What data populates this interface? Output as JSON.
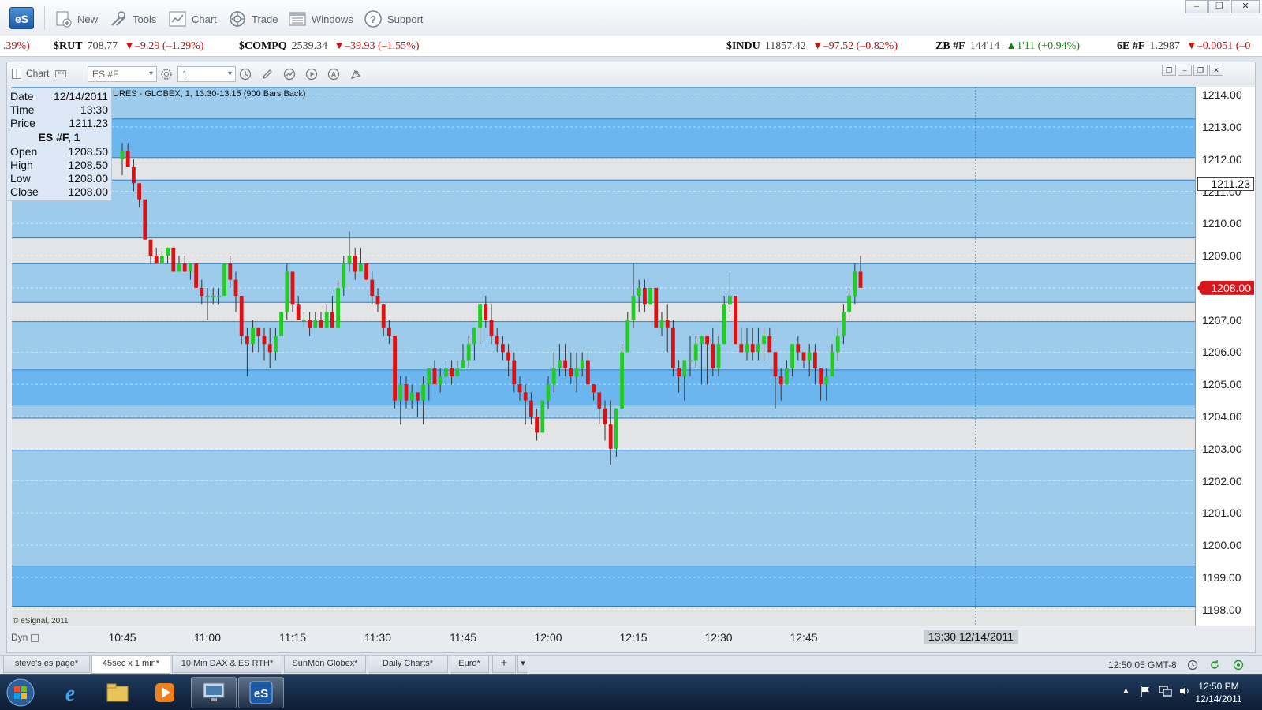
{
  "app": {
    "logo_text": "eS"
  },
  "toolbar": {
    "buttons": [
      {
        "label": "New",
        "icon": "new-page-icon"
      },
      {
        "label": "Tools",
        "icon": "tools-icon"
      },
      {
        "label": "Chart",
        "icon": "chart-icon"
      },
      {
        "label": "Trade",
        "icon": "trade-icon"
      },
      {
        "label": "Windows",
        "icon": "windows-icon"
      },
      {
        "label": "Support",
        "icon": "help-icon"
      }
    ],
    "window_controls": [
      "–",
      "❐",
      "✕"
    ]
  },
  "ticker": [
    {
      "symbol": "",
      "price": "",
      "change": ".39%)",
      "dir": "down"
    },
    {
      "symbol": "$RUT",
      "price": "708.77",
      "change": "▼–9.29 (–1.29%)",
      "dir": "down"
    },
    {
      "symbol": "$COMPQ",
      "price": "2539.34",
      "change": "▼–39.93 (–1.55%)",
      "dir": "down"
    },
    {
      "symbol": "$INDU",
      "price": "11857.42",
      "change": "▼–97.52 (–0.82%)",
      "dir": "down"
    },
    {
      "symbol": "ZB #F",
      "price": "144'14",
      "change": "▲1'11 (+0.94%)",
      "dir": "up"
    },
    {
      "symbol": "6E #F",
      "price": "1.2987",
      "change": "▼–0.0051 (–0",
      "dir": "down"
    }
  ],
  "chart_window": {
    "label": "Chart",
    "symbol_input": "ES #F",
    "interval_input": "1",
    "title": "URES - GLOBEX, 1, 13:30-13:15 (900 Bars Back)",
    "copyright": "© eSignal, 2011",
    "dyn_label": "Dyn"
  },
  "cursor_info": {
    "date_label": "Date",
    "date": "12/14/2011",
    "time_label": "Time",
    "time": "13:30",
    "price_label": "Price",
    "price": "1211.23",
    "series_label": "ES #F, 1",
    "open_label": "Open",
    "open": "1208.50",
    "high_label": "High",
    "high": "1208.50",
    "low_label": "Low",
    "low": "1208.00",
    "close_label": "Close",
    "close": "1208.00"
  },
  "chart_data": {
    "type": "candlestick",
    "ylim": [
      1197.5,
      1214.25
    ],
    "y_ticks": [
      "1214.00",
      "1213.00",
      "1212.00",
      "1211.00",
      "1210.00",
      "1209.00",
      "1208.00",
      "1207.00",
      "1206.00",
      "1205.00",
      "1204.00",
      "1203.00",
      "1202.00",
      "1201.00",
      "1200.00",
      "1199.00",
      "1198.00"
    ],
    "x_ticks": [
      "10:45",
      "11:00",
      "11:15",
      "11:30",
      "11:45",
      "12:00",
      "12:15",
      "12:30",
      "12:45"
    ],
    "last_price": "1208.00",
    "crosshair_price": "1211.23",
    "crosshair_time": "13:30 12/14/2011",
    "colors": {
      "up": "#22cc22",
      "down": "#dd1111",
      "band_dark": "#6cb6f0",
      "band_light": "#9ccbeb",
      "band_grey": "#e2e4e6"
    },
    "bands": [
      {
        "from": 1213.25,
        "to": 1214.25,
        "shade": "light"
      },
      {
        "from": 1212.05,
        "to": 1213.25,
        "shade": "dark"
      },
      {
        "from": 1211.35,
        "to": 1212.05,
        "shade": "grey"
      },
      {
        "from": 1209.55,
        "to": 1211.35,
        "shade": "light"
      },
      {
        "from": 1208.75,
        "to": 1209.55,
        "shade": "grey"
      },
      {
        "from": 1207.55,
        "to": 1208.75,
        "shade": "light"
      },
      {
        "from": 1206.95,
        "to": 1207.55,
        "shade": "grey"
      },
      {
        "from": 1205.45,
        "to": 1206.95,
        "shade": "light"
      },
      {
        "from": 1204.35,
        "to": 1205.45,
        "shade": "dark"
      },
      {
        "from": 1203.95,
        "to": 1204.35,
        "shade": "light"
      },
      {
        "from": 1202.95,
        "to": 1203.95,
        "shade": "grey"
      },
      {
        "from": 1199.35,
        "to": 1202.95,
        "shade": "light"
      },
      {
        "from": 1198.1,
        "to": 1199.35,
        "shade": "dark"
      },
      {
        "from": 1197.5,
        "to": 1198.1,
        "shade": "grey"
      }
    ],
    "candles": [
      [
        1212.0,
        1212.5,
        1211.5,
        1212.25
      ],
      [
        1212.25,
        1212.5,
        1211.75,
        1211.75
      ],
      [
        1211.75,
        1212.0,
        1211.0,
        1211.25
      ],
      [
        1211.25,
        1211.25,
        1210.5,
        1210.75
      ],
      [
        1210.75,
        1210.75,
        1209.5,
        1209.5
      ],
      [
        1209.5,
        1209.5,
        1208.75,
        1209.0
      ],
      [
        1209.0,
        1209.25,
        1208.75,
        1208.75
      ],
      [
        1208.75,
        1209.25,
        1208.75,
        1209.0
      ],
      [
        1209.0,
        1209.25,
        1208.75,
        1209.25
      ],
      [
        1209.25,
        1209.25,
        1208.5,
        1208.5
      ],
      [
        1208.5,
        1209.0,
        1208.5,
        1208.75
      ],
      [
        1208.75,
        1209.0,
        1208.5,
        1208.5
      ],
      [
        1208.5,
        1208.75,
        1208.25,
        1208.75
      ],
      [
        1208.75,
        1208.75,
        1208.0,
        1208.0
      ],
      [
        1208.0,
        1208.25,
        1207.5,
        1207.75
      ],
      [
        1207.75,
        1208.0,
        1207.0,
        1207.75
      ],
      [
        1207.75,
        1208.0,
        1207.5,
        1207.75
      ],
      [
        1207.75,
        1208.0,
        1207.5,
        1207.75
      ],
      [
        1207.75,
        1208.75,
        1207.75,
        1208.75
      ],
      [
        1208.75,
        1209.0,
        1208.0,
        1208.25
      ],
      [
        1208.25,
        1208.5,
        1207.25,
        1207.75
      ],
      [
        1207.75,
        1207.75,
        1206.25,
        1206.5
      ],
      [
        1206.5,
        1206.75,
        1205.25,
        1206.25
      ],
      [
        1206.25,
        1207.0,
        1206.0,
        1206.75
      ],
      [
        1206.75,
        1206.75,
        1206.0,
        1206.5
      ],
      [
        1206.5,
        1206.75,
        1205.75,
        1206.25
      ],
      [
        1206.25,
        1206.75,
        1205.5,
        1206.0
      ],
      [
        1206.0,
        1206.75,
        1205.75,
        1206.5
      ],
      [
        1206.5,
        1207.25,
        1206.5,
        1207.25
      ],
      [
        1207.25,
        1208.75,
        1207.0,
        1208.5
      ],
      [
        1208.5,
        1208.5,
        1207.25,
        1207.5
      ],
      [
        1207.5,
        1207.75,
        1207.0,
        1207.0
      ],
      [
        1207.0,
        1207.25,
        1206.75,
        1207.0
      ],
      [
        1207.0,
        1207.25,
        1206.5,
        1206.75
      ],
      [
        1206.75,
        1207.25,
        1206.75,
        1207.0
      ],
      [
        1207.0,
        1207.25,
        1206.75,
        1206.75
      ],
      [
        1206.75,
        1207.5,
        1206.75,
        1207.25
      ],
      [
        1207.25,
        1207.75,
        1206.75,
        1206.75
      ],
      [
        1206.75,
        1208.25,
        1206.75,
        1208.0
      ],
      [
        1208.0,
        1209.0,
        1207.75,
        1208.75
      ],
      [
        1208.75,
        1209.75,
        1208.5,
        1209.0
      ],
      [
        1209.0,
        1209.25,
        1208.25,
        1208.5
      ],
      [
        1208.5,
        1209.25,
        1208.5,
        1208.75
      ],
      [
        1208.75,
        1208.75,
        1208.25,
        1208.25
      ],
      [
        1208.25,
        1208.5,
        1207.5,
        1207.75
      ],
      [
        1207.75,
        1208.0,
        1207.25,
        1207.5
      ],
      [
        1207.5,
        1207.5,
        1206.5,
        1206.75
      ],
      [
        1206.75,
        1207.0,
        1206.25,
        1206.5
      ],
      [
        1206.5,
        1206.5,
        1204.25,
        1204.5
      ],
      [
        1204.5,
        1205.25,
        1203.75,
        1205.0
      ],
      [
        1205.0,
        1205.25,
        1204.25,
        1204.5
      ],
      [
        1204.5,
        1205.0,
        1204.25,
        1204.75
      ],
      [
        1204.75,
        1204.75,
        1204.0,
        1204.5
      ],
      [
        1204.5,
        1205.25,
        1203.75,
        1205.0
      ],
      [
        1205.0,
        1205.5,
        1204.5,
        1205.5
      ],
      [
        1205.5,
        1205.75,
        1205.0,
        1205.0
      ],
      [
        1205.0,
        1205.5,
        1204.75,
        1205.25
      ],
      [
        1205.25,
        1205.75,
        1205.0,
        1205.5
      ],
      [
        1205.5,
        1205.75,
        1205.0,
        1205.25
      ],
      [
        1205.25,
        1205.75,
        1205.25,
        1205.5
      ],
      [
        1205.5,
        1206.25,
        1205.5,
        1205.75
      ],
      [
        1205.75,
        1206.5,
        1205.5,
        1206.25
      ],
      [
        1206.25,
        1206.75,
        1205.75,
        1206.75
      ],
      [
        1206.75,
        1207.5,
        1206.25,
        1207.5
      ],
      [
        1207.5,
        1207.75,
        1206.75,
        1207.0
      ],
      [
        1207.0,
        1207.5,
        1206.25,
        1206.5
      ],
      [
        1206.5,
        1206.75,
        1206.0,
        1206.25
      ],
      [
        1206.25,
        1206.5,
        1205.75,
        1206.0
      ],
      [
        1206.0,
        1206.25,
        1205.25,
        1205.75
      ],
      [
        1205.75,
        1206.0,
        1204.75,
        1205.0
      ],
      [
        1205.0,
        1205.25,
        1204.5,
        1204.75
      ],
      [
        1204.75,
        1205.0,
        1203.75,
        1204.5
      ],
      [
        1204.5,
        1204.75,
        1203.75,
        1204.0
      ],
      [
        1204.0,
        1204.25,
        1203.25,
        1203.5
      ],
      [
        1203.5,
        1204.5,
        1203.5,
        1204.5
      ],
      [
        1204.5,
        1205.25,
        1204.25,
        1205.0
      ],
      [
        1205.0,
        1206.0,
        1204.75,
        1205.5
      ],
      [
        1205.5,
        1206.25,
        1205.25,
        1205.75
      ],
      [
        1205.75,
        1206.25,
        1205.25,
        1205.5
      ],
      [
        1205.5,
        1206.0,
        1205.0,
        1205.25
      ],
      [
        1205.25,
        1206.0,
        1204.75,
        1205.5
      ],
      [
        1205.5,
        1206.0,
        1205.25,
        1205.75
      ],
      [
        1205.75,
        1206.0,
        1205.0,
        1205.0
      ],
      [
        1205.0,
        1205.0,
        1204.5,
        1204.75
      ],
      [
        1204.75,
        1204.75,
        1203.75,
        1204.25
      ],
      [
        1204.25,
        1204.5,
        1203.25,
        1203.75
      ],
      [
        1203.75,
        1204.5,
        1202.5,
        1203.0
      ],
      [
        1203.0,
        1204.0,
        1202.75,
        1204.25
      ],
      [
        1204.25,
        1206.25,
        1204.25,
        1206.0
      ],
      [
        1206.0,
        1207.25,
        1206.0,
        1207.0
      ],
      [
        1207.0,
        1208.75,
        1206.75,
        1207.75
      ],
      [
        1207.75,
        1208.25,
        1207.25,
        1208.0
      ],
      [
        1208.0,
        1208.25,
        1207.25,
        1207.5
      ],
      [
        1207.5,
        1208.0,
        1207.5,
        1208.0
      ],
      [
        1208.0,
        1208.0,
        1206.75,
        1206.75
      ],
      [
        1206.75,
        1207.25,
        1206.5,
        1207.0
      ],
      [
        1207.0,
        1207.5,
        1206.0,
        1206.75
      ],
      [
        1206.75,
        1207.0,
        1205.25,
        1205.5
      ],
      [
        1205.5,
        1205.75,
        1204.75,
        1205.25
      ],
      [
        1205.25,
        1205.75,
        1204.5,
        1205.75
      ],
      [
        1205.75,
        1206.5,
        1205.25,
        1205.75
      ],
      [
        1205.75,
        1206.5,
        1205.5,
        1206.25
      ],
      [
        1206.25,
        1206.5,
        1205.0,
        1206.5
      ],
      [
        1206.5,
        1206.5,
        1205.0,
        1206.25
      ],
      [
        1206.25,
        1206.75,
        1205.25,
        1205.5
      ],
      [
        1205.5,
        1206.5,
        1205.25,
        1206.25
      ],
      [
        1206.25,
        1207.75,
        1206.25,
        1207.5
      ],
      [
        1207.5,
        1208.5,
        1207.25,
        1207.75
      ],
      [
        1207.75,
        1207.75,
        1206.25,
        1206.25
      ],
      [
        1206.25,
        1206.75,
        1206.0,
        1206.0
      ],
      [
        1206.0,
        1206.75,
        1205.75,
        1206.25
      ],
      [
        1206.25,
        1206.75,
        1205.75,
        1206.0
      ],
      [
        1206.0,
        1206.75,
        1205.75,
        1206.25
      ],
      [
        1206.25,
        1206.75,
        1205.75,
        1206.5
      ],
      [
        1206.5,
        1206.75,
        1206.0,
        1206.0
      ],
      [
        1206.0,
        1206.0,
        1204.25,
        1205.25
      ],
      [
        1205.25,
        1205.5,
        1204.5,
        1205.0
      ],
      [
        1205.0,
        1205.75,
        1205.0,
        1205.5
      ],
      [
        1205.5,
        1206.25,
        1205.25,
        1206.25
      ],
      [
        1206.25,
        1206.5,
        1205.75,
        1206.0
      ],
      [
        1206.0,
        1206.0,
        1205.5,
        1205.75
      ],
      [
        1205.75,
        1206.25,
        1205.25,
        1206.0
      ],
      [
        1206.0,
        1206.25,
        1205.0,
        1205.5
      ],
      [
        1205.5,
        1205.5,
        1204.5,
        1205.0
      ],
      [
        1205.0,
        1205.5,
        1204.5,
        1205.25
      ],
      [
        1205.25,
        1206.25,
        1205.25,
        1206.0
      ],
      [
        1206.0,
        1206.75,
        1205.75,
        1206.5
      ],
      [
        1206.5,
        1207.5,
        1206.25,
        1207.25
      ],
      [
        1207.25,
        1208.0,
        1207.0,
        1207.75
      ],
      [
        1207.75,
        1208.75,
        1207.5,
        1208.5
      ],
      [
        1208.5,
        1209.0,
        1208.0,
        1208.0
      ]
    ]
  },
  "page_tabs": [
    "steve's es page*",
    "45sec x 1 min*",
    "10 Min DAX & ES RTH*",
    "SunMon Globex*",
    "Daily Charts*",
    "Euro*",
    "+",
    "▾"
  ],
  "active_tab_index": 1,
  "status": {
    "time": "12:50:05 GMT-8"
  },
  "taskbar": {
    "apps": [
      "start-orb",
      "internet-explorer",
      "file-explorer",
      "media-player",
      "remote-desktop",
      "esignal"
    ],
    "clock_time": "12:50 PM",
    "clock_date": "12/14/2011"
  }
}
